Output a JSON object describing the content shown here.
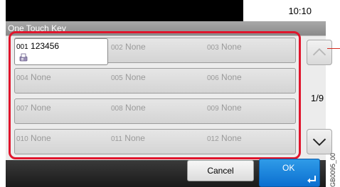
{
  "status": {
    "time": "10:10"
  },
  "title": "One Touch Key",
  "keys": [
    {
      "num": "001",
      "name": "123456",
      "selected": true,
      "icon": "fax-icon"
    },
    {
      "num": "002",
      "name": "None"
    },
    {
      "num": "003",
      "name": "None"
    },
    {
      "num": "004",
      "name": "None"
    },
    {
      "num": "005",
      "name": "None"
    },
    {
      "num": "006",
      "name": "None"
    },
    {
      "num": "007",
      "name": "None"
    },
    {
      "num": "008",
      "name": "None"
    },
    {
      "num": "009",
      "name": "None"
    },
    {
      "num": "010",
      "name": "None"
    },
    {
      "num": "011",
      "name": "None"
    },
    {
      "num": "012",
      "name": "None"
    }
  ],
  "paging": {
    "indicator": "1/9",
    "up_icon": "chevron-up-icon",
    "down_icon": "chevron-down-icon"
  },
  "buttons": {
    "cancel": "Cancel",
    "ok": "OK",
    "ok_icon": "enter-icon"
  },
  "doc_code": "GB0095_00",
  "colors": {
    "highlight": "#e0152c",
    "ok": "#1580dc",
    "title_bar": "#999999"
  }
}
